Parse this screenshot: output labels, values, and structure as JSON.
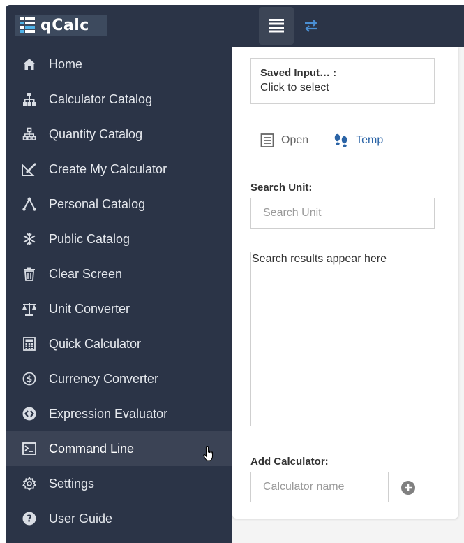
{
  "app": {
    "logo_text": "qCalc"
  },
  "topbar": {
    "menu_icon": "list-icon",
    "swap_icon": "swap-arrows-icon"
  },
  "sidebar": {
    "items": [
      {
        "label": "Home",
        "icon": "home-icon"
      },
      {
        "label": "Calculator Catalog",
        "icon": "sitemap-icon"
      },
      {
        "label": "Quantity Catalog",
        "icon": "hierarchy-icon"
      },
      {
        "label": "Create My Calculator",
        "icon": "ruler-pencil-icon"
      },
      {
        "label": "Personal Catalog",
        "icon": "branch-icon"
      },
      {
        "label": "Public Catalog",
        "icon": "snowflake-icon"
      },
      {
        "label": "Clear Screen",
        "icon": "trash-icon"
      },
      {
        "label": "Unit Converter",
        "icon": "balance-scale-icon"
      },
      {
        "label": "Quick Calculator",
        "icon": "calculator-icon"
      },
      {
        "label": "Currency Converter",
        "icon": "dollar-coin-icon"
      },
      {
        "label": "Expression Evaluator",
        "icon": "code-circle-icon"
      },
      {
        "label": "Command Line",
        "icon": "terminal-icon",
        "active": true
      },
      {
        "label": "Settings",
        "icon": "gear-icon"
      },
      {
        "label": "User Guide",
        "icon": "question-circle-icon"
      }
    ]
  },
  "panel": {
    "saved_title": "Saved Input… :",
    "saved_sub": "Click to select",
    "open_label": "Open",
    "temp_label": "Temp",
    "search_label": "Search Unit:",
    "search_placeholder": "Search Unit",
    "results_text": "Search results appear here",
    "add_label": "Add Calculator:",
    "add_placeholder": "Calculator name"
  },
  "colors": {
    "sidebar_bg": "#2b3447",
    "active_bg": "#3b4355",
    "accent": "#2b64a6"
  }
}
